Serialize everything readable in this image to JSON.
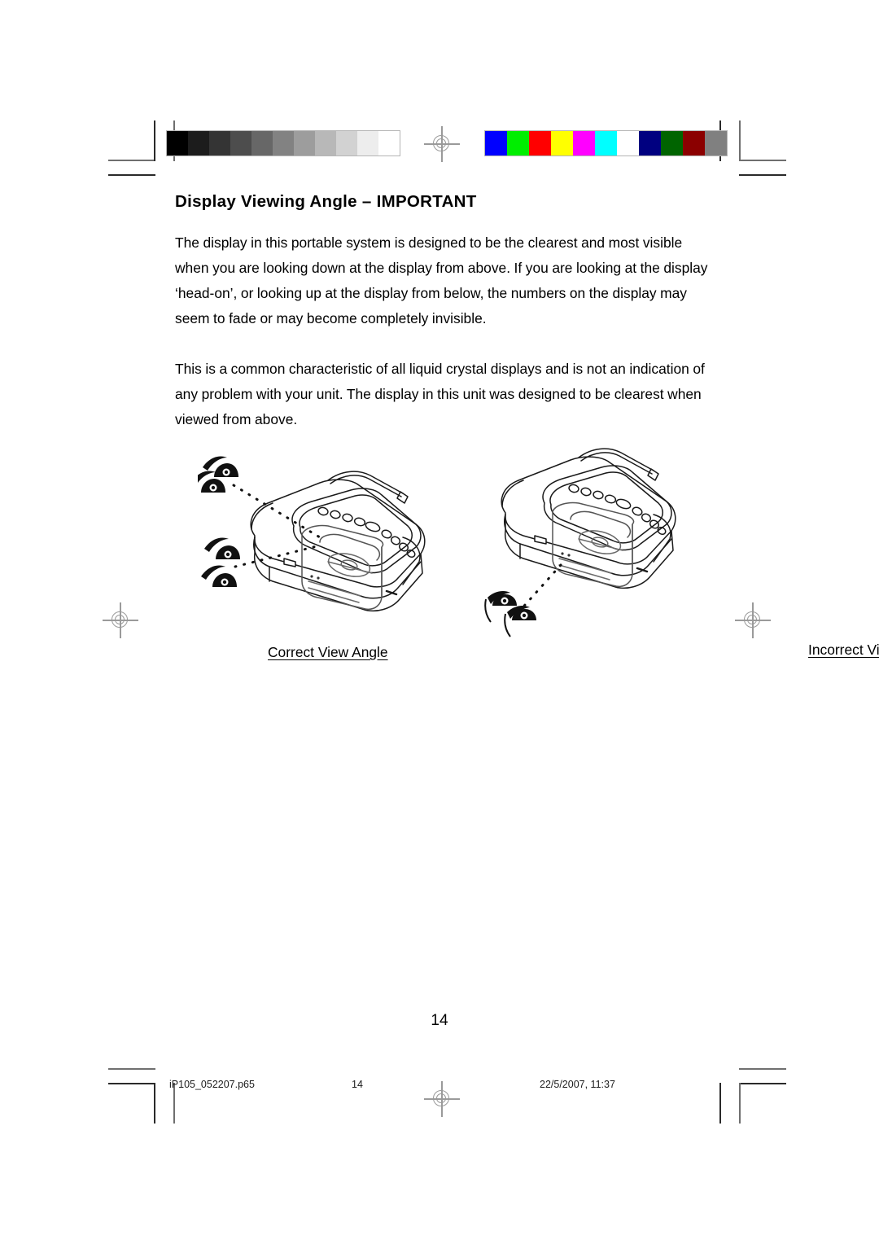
{
  "document": {
    "title": "Display Viewing Angle – IMPORTANT",
    "paragraphs": [
      "The display in this portable system is designed to be the clearest and most visible when you are looking down at the display from above. If you are looking at the display ‘head-on’, or looking up at the display from below, the numbers on the display may seem to fade or may become completely invisible.",
      "This is a common characteristic of all liquid crystal displays and is not an indication of any problem with your unit. The display in this unit was designed to be clearest when viewed from above."
    ],
    "page_number": "14"
  },
  "figures": [
    {
      "caption": "Correct View Angle",
      "illustration": "portable-cd-boombox-viewed-from-above",
      "eye_count": 4,
      "sight_lines": 2
    },
    {
      "caption": "Incorrect View Angle",
      "illustration": "portable-cd-boombox-viewed-from-below",
      "eye_count": 2,
      "sight_lines": 1
    }
  ],
  "footer": {
    "file_name": "iP105_052207.p65",
    "page_label": "14",
    "timestamp": "22/5/2007, 11:37"
  },
  "print_marks": {
    "grayscale_bar": [
      "#000000",
      "#1c1c1c",
      "#343434",
      "#4d4d4d",
      "#676767",
      "#828282",
      "#9d9d9d",
      "#b8b8b8",
      "#d2d2d2",
      "#ededed",
      "#ffffff"
    ],
    "color_bar": [
      "#0000ff",
      "#00ee00",
      "#ff0000",
      "#ffff00",
      "#ff00ff",
      "#00ffff",
      "#ffffff",
      "#000080",
      "#006400",
      "#8b0000",
      "#808080"
    ],
    "registration_target": "registration-crosshair"
  }
}
